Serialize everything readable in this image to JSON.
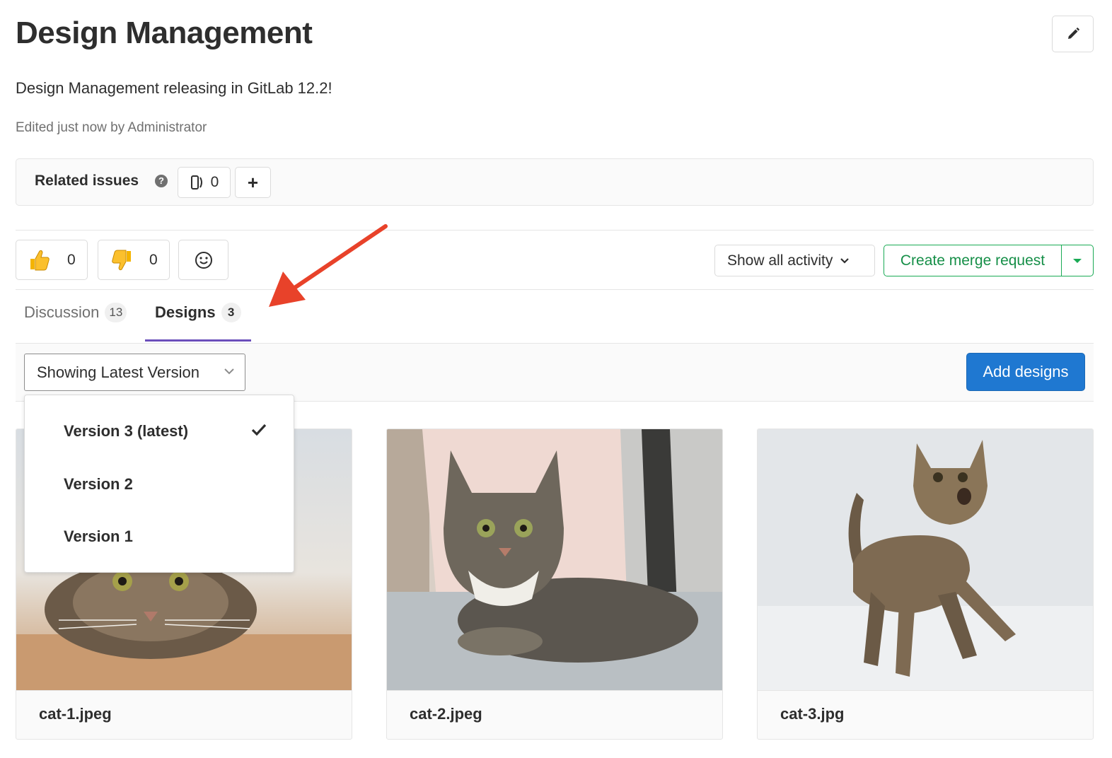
{
  "issue": {
    "title": "Design Management",
    "description": "Design Management releasing in GitLab 12.2!",
    "edited": "Edited just now by Administrator"
  },
  "related_issues": {
    "label": "Related issues",
    "help_icon": "question-circle-icon",
    "count": "0"
  },
  "awards": {
    "thumbs_up": "0",
    "thumbs_down": "0"
  },
  "activity_filter": "Show all activity",
  "merge_request_button": "Create merge request",
  "tabs": [
    {
      "label": "Discussion",
      "count": "13"
    },
    {
      "label": "Designs",
      "count": "3"
    }
  ],
  "version_select": {
    "value": "Showing Latest Version",
    "options": [
      "Version 3 (latest)",
      "Version 2",
      "Version 1"
    ]
  },
  "add_designs_button": "Add designs",
  "designs": [
    {
      "filename": "cat-1.jpeg"
    },
    {
      "filename": "cat-2.jpeg"
    },
    {
      "filename": "cat-3.jpg"
    }
  ],
  "colors": {
    "primary_blue": "#1f78d1",
    "success_green": "#1aaa55",
    "tab_active": "#6b4fbb",
    "annotation_arrow": "#e8422a"
  }
}
